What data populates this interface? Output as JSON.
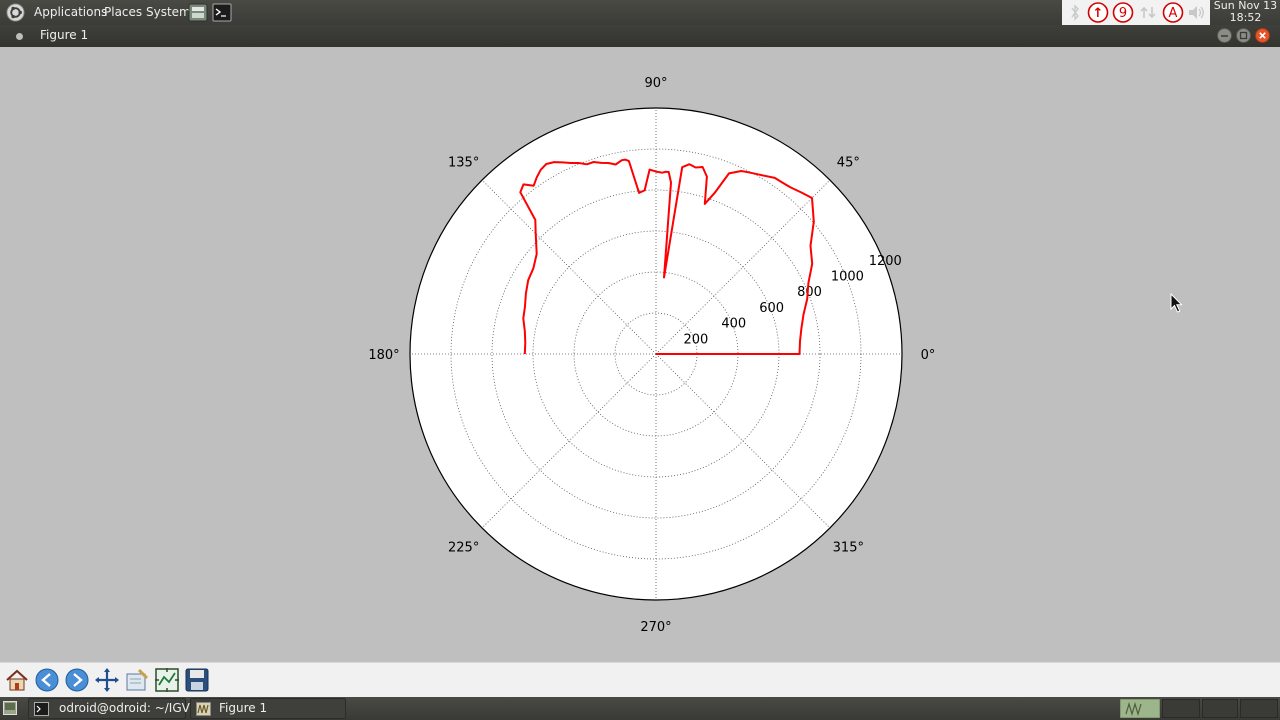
{
  "top_panel": {
    "menus": [
      "Applications",
      "Places",
      "System"
    ],
    "tray": {
      "badge_up": "↑",
      "badge_count": "9",
      "badge_a": "A"
    },
    "clock": {
      "date": "Sun Nov 13",
      "time": "18:52"
    }
  },
  "window": {
    "title": "Figure 1"
  },
  "chart_data": {
    "type": "polar-line",
    "angle_ticks_deg": [
      0,
      45,
      90,
      135,
      180,
      225,
      270,
      315
    ],
    "angle_tick_labels": [
      "0°",
      "45°",
      "90°",
      "135°",
      "180°",
      "225°",
      "270°",
      "315°"
    ],
    "radial_ticks": [
      200,
      400,
      600,
      800,
      1000,
      1200
    ],
    "radial_tick_labels": [
      "200",
      "400",
      "600",
      "800",
      "1000",
      "1200"
    ],
    "rmax": 1200,
    "grid": true,
    "series": [
      {
        "color": "#ff0000",
        "theta_deg": [
          0,
          0,
          5,
          10,
          15,
          20,
          25,
          30,
          35,
          40,
          45,
          48,
          51,
          53,
          56,
          60,
          63,
          65,
          68,
          70,
          72,
          74,
          76,
          78,
          80,
          82,
          84,
          85,
          86,
          87,
          88,
          90,
          92,
          94,
          96,
          98,
          99,
          100,
          102,
          104,
          106,
          108,
          110,
          112,
          114,
          116,
          118,
          120,
          122,
          124,
          126,
          128,
          130,
          132,
          135,
          140,
          145,
          150,
          155,
          160,
          165,
          170,
          175,
          180
        ],
        "r": [
          0,
          700,
          705,
          720,
          745,
          785,
          820,
          880,
          920,
          1005,
          1076,
          1060,
          1045,
          1040,
          1036,
          1010,
          995,
          985,
          950,
          835,
          770,
          900,
          940,
          930,
          940,
          920,
          375,
          840,
          890,
          890,
          885,
          890,
          900,
          800,
          790,
          950,
          960,
          960,
          945,
          960,
          970,
          985,
          985,
          1005,
          1020,
          1040,
          1060,
          1070,
          1060,
          1040,
          1015,
          1050,
          1030,
          880,
          830,
          760,
          730,
          720,
          700,
          680,
          670,
          650,
          640,
          640
        ]
      }
    ]
  }
}
